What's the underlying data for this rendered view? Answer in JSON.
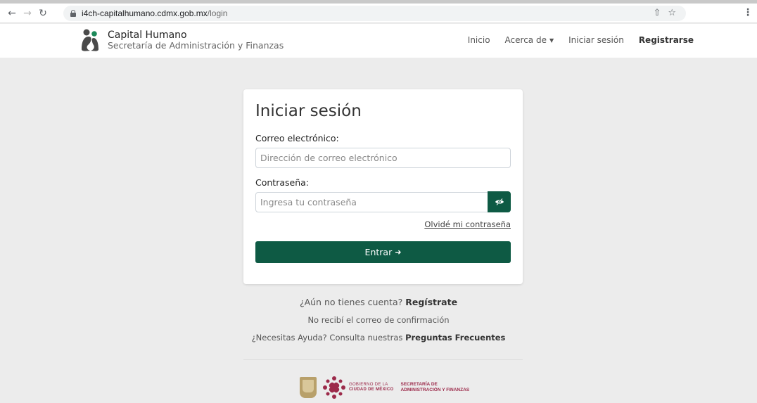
{
  "browser": {
    "url_host": "i4ch-capitalhumano.cdmx.gob.mx",
    "url_path": "/login",
    "icons": [
      "back-icon",
      "forward-icon",
      "reload-icon",
      "lock-icon",
      "share-icon",
      "star-icon",
      "menu-icon"
    ]
  },
  "header": {
    "brand_title": "Capital Humano",
    "brand_subtitle": "Secretaría de Administración y Finanzas",
    "nav": {
      "inicio": "Inicio",
      "acerca": "Acerca de",
      "iniciar": "Iniciar sesión",
      "registrarse": "Registrarse"
    }
  },
  "login": {
    "title": "Iniciar sesión",
    "email_label": "Correo electrónico:",
    "email_placeholder": "Dirección de correo electrónico",
    "password_label": "Contraseña:",
    "password_placeholder": "Ingresa tu contraseña",
    "forgot": "Olvidé mi contraseña",
    "submit": "Entrar"
  },
  "below": {
    "no_account": "¿Aún no tienes cuenta?",
    "register": "Regístrate",
    "no_confirmation": "No recibí el correo de confirmación",
    "help_prefix": "¿Necesitas Ayuda? Consulta nuestras",
    "faq": "Preguntas Frecuentes"
  },
  "footer": {
    "gob_line1": "GOBIERNO DE LA",
    "gob_line2": "CIUDAD DE MÉXICO",
    "sec_line1": "SECRETARÍA DE",
    "sec_line2": "ADMINISTRACIÓN Y FINANZAS"
  },
  "colors": {
    "primary": "#0e5a44",
    "page_bg": "#ececec",
    "brand_maroon": "#9c2a4a"
  }
}
